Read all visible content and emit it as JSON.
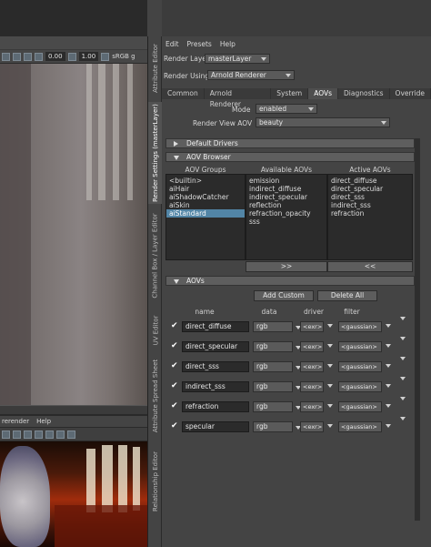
{
  "viewport": {
    "zoom_field_1": "0.00",
    "zoom_field_2": "1.00",
    "colorspace": "sRGB g",
    "bottom_menu": [
      "rerender",
      "Help"
    ]
  },
  "side_tabs": [
    "Attribute Editor",
    "Render Settings (masterLayer)",
    "Channel Box / Layer Editor",
    "UV Editor",
    "Attribute Spread Sheet",
    "Relationship Editor"
  ],
  "menu": [
    "Edit",
    "Presets",
    "Help"
  ],
  "render_layer": {
    "label": "Render Layer",
    "value": "masterLayer"
  },
  "render_using": {
    "label": "Render Using",
    "value": "Arnold Renderer"
  },
  "tabs": [
    "Common",
    "Arnold Renderer",
    "System",
    "AOVs",
    "Diagnostics",
    "Override"
  ],
  "active_tab": "AOVs",
  "mode": {
    "label": "Mode",
    "value": "enabled"
  },
  "render_view_aov": {
    "label": "Render View AOV",
    "value": "beauty"
  },
  "sections": {
    "default_drivers": "Default Drivers",
    "aov_browser": "AOV Browser",
    "aovs": "AOVs"
  },
  "browser": {
    "groups_header": "AOV Groups",
    "available_header": "Available AOVs",
    "active_header": "Active AOVs",
    "groups": [
      "<builtin>",
      "aiHair",
      "aiShadowCatcher",
      "aiSkin",
      "aiStandard"
    ],
    "selected_group": "aiStandard",
    "available": [
      "emission",
      "indirect_diffuse",
      "indirect_specular",
      "reflection",
      "refraction_opacity",
      "sss"
    ],
    "active": [
      "direct_diffuse",
      "direct_specular",
      "direct_sss",
      "indirect_sss",
      "refraction"
    ],
    "add_button": ">>",
    "remove_button": "<<"
  },
  "aov_buttons": {
    "add_custom": "Add Custom",
    "delete_all": "Delete All"
  },
  "aov_table": {
    "headers": [
      "name",
      "data",
      "driver",
      "filter"
    ],
    "rows": [
      {
        "enabled": true,
        "name": "direct_diffuse",
        "data": "rgb",
        "driver": "<exr>",
        "filter": "<gaussian>"
      },
      {
        "enabled": true,
        "name": "direct_specular",
        "data": "rgb",
        "driver": "<exr>",
        "filter": "<gaussian>"
      },
      {
        "enabled": true,
        "name": "direct_sss",
        "data": "rgb",
        "driver": "<exr>",
        "filter": "<gaussian>"
      },
      {
        "enabled": true,
        "name": "indirect_sss",
        "data": "rgb",
        "driver": "<exr>",
        "filter": "<gaussian>"
      },
      {
        "enabled": true,
        "name": "refraction",
        "data": "rgb",
        "driver": "<exr>",
        "filter": "<gaussian>"
      },
      {
        "enabled": true,
        "name": "specular",
        "data": "rgb",
        "driver": "<exr>",
        "filter": "<gaussian>"
      }
    ]
  },
  "colors": {
    "selection": "#5285a6",
    "panel": "#444444",
    "field": "#2b2b2b"
  }
}
